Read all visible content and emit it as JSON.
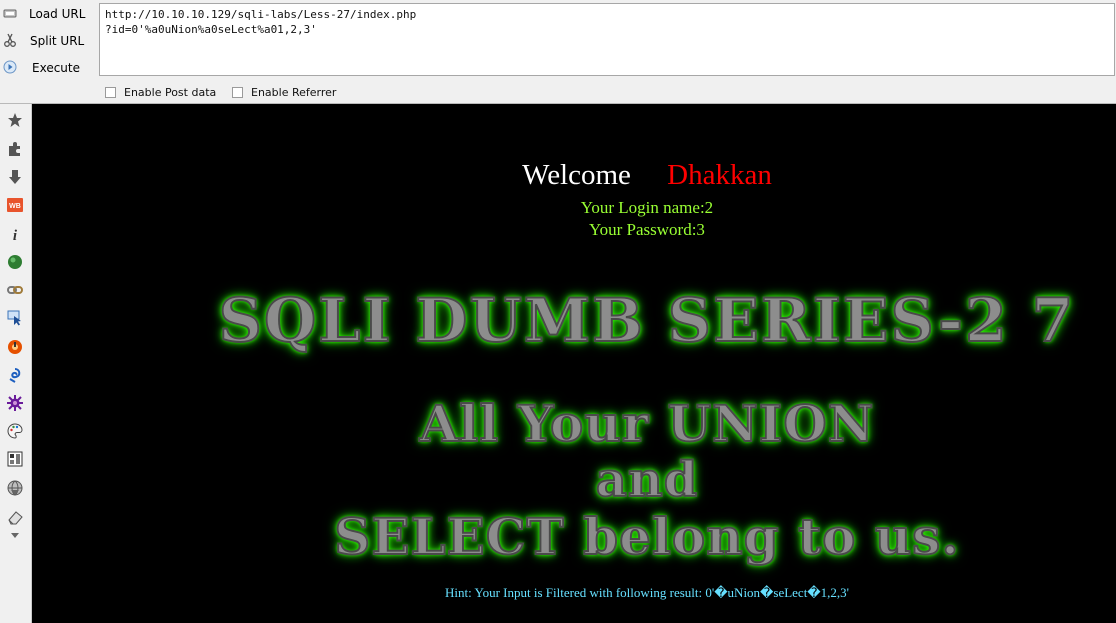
{
  "hackbar": {
    "load_url_label": "Load URL",
    "split_url_label": "Split URL",
    "execute_label": "Execute",
    "url_line1": "http://10.10.10.129/sqli-labs/Less-27/index.php",
    "url_line2": "?id=0'%a0uNion%a0seLect%a01,2,3'",
    "enable_post_label": "Enable Post data",
    "enable_referrer_label": "Enable Referrer"
  },
  "sidebar": {
    "icons": [
      "star-icon",
      "puzzle-icon",
      "download-arrow-icon",
      "web-developer-icon",
      "info-icon",
      "green-ball-icon",
      "link-chain-icon",
      "cursor-select-icon",
      "orange-circle-icon",
      "blue-swirl-icon",
      "purple-splat-icon",
      "palette-icon",
      "layout-icon",
      "globe-icon",
      "eraser-icon"
    ]
  },
  "page": {
    "welcome": "Welcome",
    "name": "Dhakkan",
    "login_name": "Your Login name:2",
    "password": "Your Password:3",
    "title_banner": "SQLI DUMB SERIES-2 7",
    "union_line": "All Your UNION",
    "and_line": "and",
    "select_line": "SELECT belong to us.",
    "hint": "Hint: Your Input is Filtered with following result: 0'�uNion�seLect�1,2,3'"
  },
  "colors": {
    "page_bg": "#000000",
    "welcome": "#ffffff",
    "name": "#ff0000",
    "login_text": "#99ff33",
    "hint_text": "#66e0ff",
    "banner_glow": "#33ff00"
  }
}
